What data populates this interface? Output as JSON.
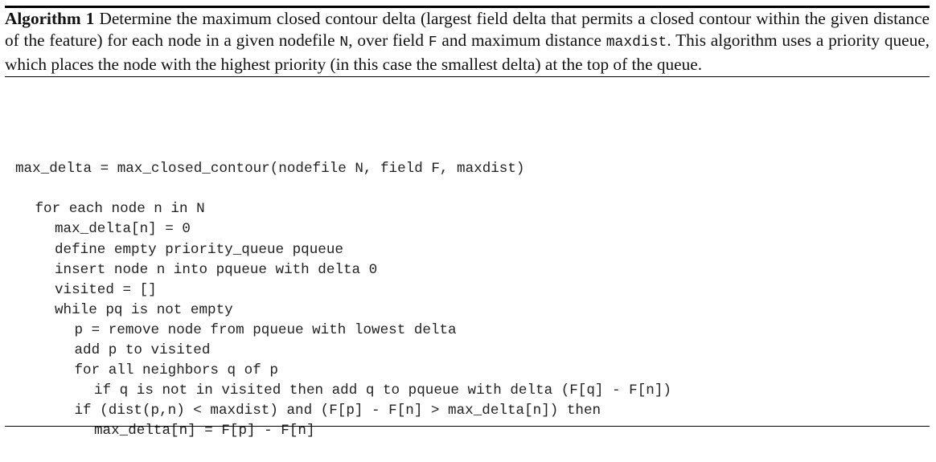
{
  "algorithm": {
    "label": "Algorithm 1",
    "caption_parts": [
      " Determine the maximum closed contour delta (largest field delta that permits a closed contour within the given distance of the feature) for each node in a given nodefile ",
      "N",
      ", over field ",
      "F",
      " and maximum distance ",
      "maxdist",
      ". This algorithm uses a priority queue, which places the node with the highest priority (in this case the smallest delta) at the top of the queue."
    ],
    "signature": "max_delta = max_closed_contour(nodefile N, field F, maxdist)",
    "body": [
      {
        "indent": 1,
        "text": "for each node n in N"
      },
      {
        "indent": 2,
        "text": "max_delta[n] = 0"
      },
      {
        "indent": 2,
        "text": "define empty priority_queue pqueue"
      },
      {
        "indent": 2,
        "text": "insert node n into pqueue with delta 0"
      },
      {
        "indent": 2,
        "text": "visited = []"
      },
      {
        "indent": 2,
        "text": "while pq is not empty"
      },
      {
        "indent": 3,
        "text": "p = remove node from pqueue with lowest delta"
      },
      {
        "indent": 3,
        "text": "add p to visited"
      },
      {
        "indent": 3,
        "text": "for all neighbors q of p"
      },
      {
        "indent": 4,
        "text": "if q is not in visited then add q to pqueue with delta (F[q] - F[n])"
      },
      {
        "indent": 3,
        "text": "if (dist(p,n) < maxdist) and (F[p] - F[n] > max_delta[n]) then"
      },
      {
        "indent": 4,
        "text": "max_delta[n] = F[p] - F[n]"
      }
    ]
  }
}
